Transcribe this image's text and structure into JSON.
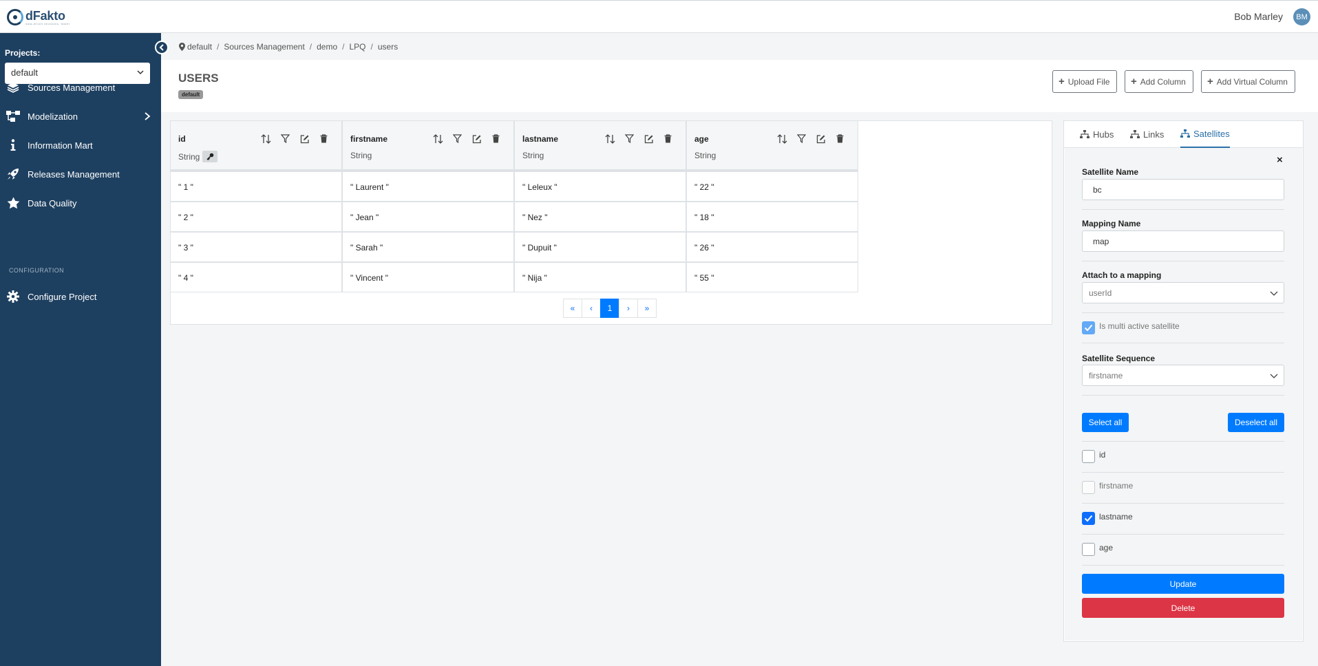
{
  "header": {
    "logo_text": "dFakto",
    "logo_tagline": "data-driven decisions, faster",
    "user_name": "Bob Marley",
    "user_initials": "BM"
  },
  "sidebar": {
    "projects_label": "Projects:",
    "project_selected": "default",
    "items": [
      {
        "label": "Sources Management",
        "icon": "layers-icon"
      },
      {
        "label": "Modelization",
        "icon": "diagram-icon"
      },
      {
        "label": "Information Mart",
        "icon": "info-icon"
      },
      {
        "label": "Releases Management",
        "icon": "rocket-icon"
      },
      {
        "label": "Data Quality",
        "icon": "star-icon"
      }
    ],
    "config_label": "CONFIGURATION",
    "config_item": "Configure Project"
  },
  "breadcrumb": [
    "default",
    "Sources Management",
    "demo",
    "LPQ",
    "users"
  ],
  "page": {
    "title": "USERS",
    "badge": "default",
    "buttons": {
      "upload": "Upload File",
      "add_column": "Add Column",
      "add_virtual": "Add Virtual Column"
    }
  },
  "table": {
    "columns": [
      {
        "name": "id",
        "type": "String",
        "is_key": true
      },
      {
        "name": "firstname",
        "type": "String"
      },
      {
        "name": "lastname",
        "type": "String"
      },
      {
        "name": "age",
        "type": "String"
      }
    ],
    "rows": [
      [
        "\" 1 \"",
        "\" Laurent \"",
        "\" Leleux \"",
        "\" 22 \""
      ],
      [
        "\" 2 \"",
        "\" Jean \"",
        "\" Nez \"",
        "\" 18 \""
      ],
      [
        "\" 3 \"",
        "\" Sarah \"",
        "\" Dupuit \"",
        "\" 26 \""
      ],
      [
        "\" 4 \"",
        "\" Vincent \"",
        "\" Nija \"",
        "\" 55 \""
      ]
    ],
    "pager": {
      "first": "«",
      "prev": "‹",
      "current": "1",
      "next": "›",
      "last": "»"
    }
  },
  "panel": {
    "tabs": [
      "Hubs",
      "Links",
      "Satellites"
    ],
    "active_tab": "Satellites",
    "close": "×",
    "satellite_name_label": "Satellite Name",
    "satellite_name_value": "bc",
    "mapping_name_label": "Mapping Name",
    "mapping_name_value": "map",
    "attach_label": "Attach to a mapping",
    "attach_value": "userId",
    "multi_active_label": "Is multi active satellite",
    "multi_active_checked": true,
    "sequence_label": "Satellite Sequence",
    "sequence_value": "firstname",
    "select_all": "Select all",
    "deselect_all": "Deselect all",
    "fields": [
      {
        "label": "id",
        "checked": false,
        "disabled": false
      },
      {
        "label": "firstname",
        "checked": false,
        "disabled": true
      },
      {
        "label": "lastname",
        "checked": true,
        "disabled": false
      },
      {
        "label": "age",
        "checked": false,
        "disabled": false
      }
    ],
    "update": "Update",
    "delete": "Delete"
  },
  "colors": {
    "sidebar_bg": "#1e4060",
    "primary": "#007bff",
    "danger": "#dc3545",
    "active_tab": "#2a6fa8"
  }
}
